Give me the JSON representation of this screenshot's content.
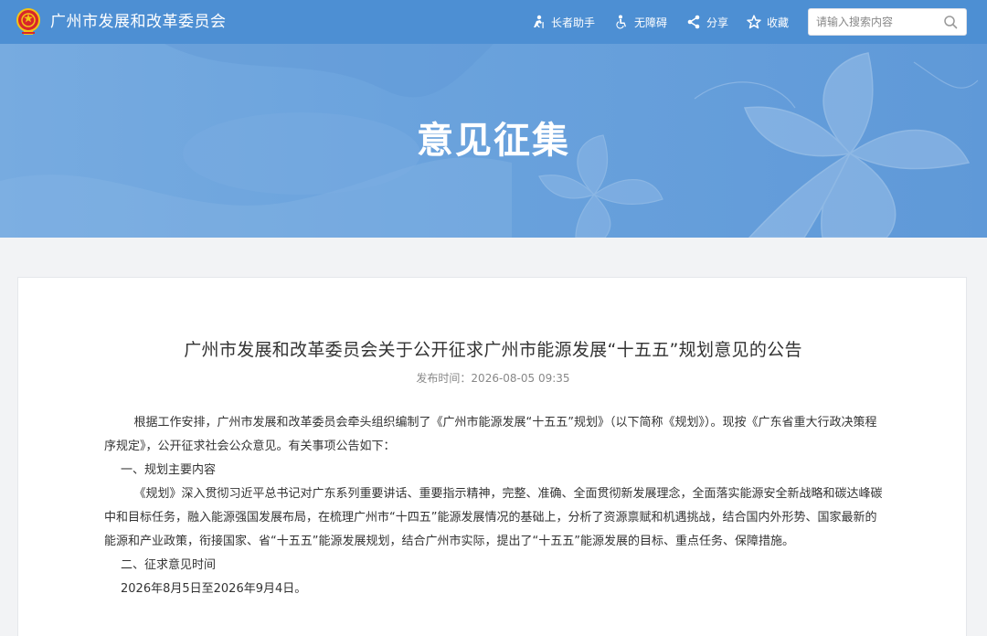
{
  "header": {
    "site_name": "广州市发展和改革委员会",
    "tools": [
      {
        "label": "长者助手",
        "icon": "elder-icon"
      },
      {
        "label": "无障碍",
        "icon": "accessibility-icon"
      },
      {
        "label": "分享",
        "icon": "share-icon"
      },
      {
        "label": "收藏",
        "icon": "star-icon"
      }
    ],
    "search_placeholder": "请输入搜索内容"
  },
  "banner": {
    "title": "意见征集"
  },
  "article": {
    "title": "广州市发展和改革委员会关于公开征求广州市能源发展“十五五”规划意见的公告",
    "publish_time": "发布时间：2026-08-05 09:35",
    "paragraphs": [
      "根据工作安排，广州市发展和改革委员会牵头组织编制了《广州市能源发展“十五五”规划》（以下简称《规划》）。现按《广东省重大行政决策程序规定》，公开征求社会公众意见。有关事项公告如下：",
      "一、规划主要内容",
      "《规划》深入贯彻习近平总书记对广东系列重要讲话、重要指示精神，完整、准确、全面贯彻新发展理念，全面落实能源安全新战略和碳达峰碳中和目标任务，融入能源强国发展布局，在梳理广州市“十四五”能源发展情况的基础上，分析了资源禀赋和机遇挑战，结合国内外形势、国家最新的能源和产业政策，衔接国家、省“十五五”能源发展规划，结合广州市实际，提出了“十五五”能源发展的目标、重点任务、保障措施。",
      "二、征求意见时间",
      "2026年8月5日至2026年9月4日。"
    ]
  },
  "colors": {
    "header_bg": "#4d8fd3",
    "banner_bg": "#6ba3dd",
    "page_bg": "#f2f3f5"
  }
}
